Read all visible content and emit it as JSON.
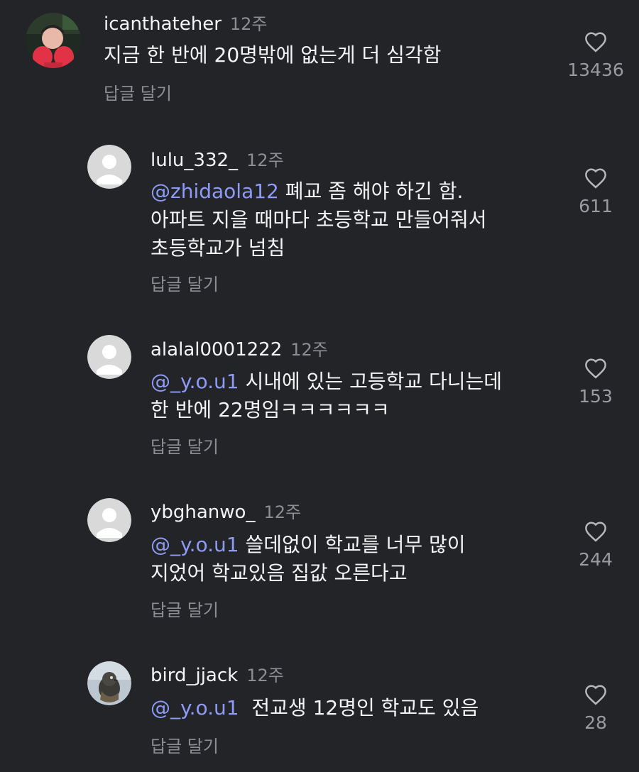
{
  "comments": [
    {
      "username": "icanthateher",
      "time": "12주",
      "text_lines": [
        "지금 한 반에 20명밖에 없는게 더 심각함"
      ],
      "reply_label": "답글 달기",
      "likes": "13436"
    },
    {
      "username": "lulu_332_",
      "time": "12주",
      "mention": "zhidaola12",
      "text_lines": [
        "폐교 좀 해야 하긴 함.",
        "아파트 지을 때마다 초등학교 만들어줘서",
        "초등학교가 넘침"
      ],
      "reply_label": "답글 달기",
      "likes": "611"
    },
    {
      "username": "alalal0001222",
      "time": "12주",
      "mention": "_y.o.u1",
      "text_lines": [
        "시내에 있는 고등학교 다니는데",
        "한 반에 22명임ㅋㅋㅋㅋㅋㅋ"
      ],
      "reply_label": "답글 달기",
      "likes": "153"
    },
    {
      "username": "ybghanwo_",
      "time": "12주",
      "mention": "_y.o.u1",
      "text_lines": [
        "쓸데없이 학교를 너무 많이",
        "지었어 학교있음 집값 오른다고"
      ],
      "reply_label": "답글 달기",
      "likes": "244"
    },
    {
      "username": "bird_jjack",
      "time": "12주",
      "mention": "_y.o.u1",
      "text_lines": [
        "전교생 12명인 학교도 있음"
      ],
      "reply_label": "답글 달기",
      "likes": "28"
    }
  ],
  "mention_symbol": "@",
  "colors": {
    "background": "#232428",
    "text": "#f4f4f4",
    "muted": "#8d8e93",
    "mention": "#8e9bf5",
    "default_avatar": "#d9d9d9"
  },
  "icons": {
    "like": "heart-outline-icon",
    "default_avatar": "default-avatar-icon"
  }
}
